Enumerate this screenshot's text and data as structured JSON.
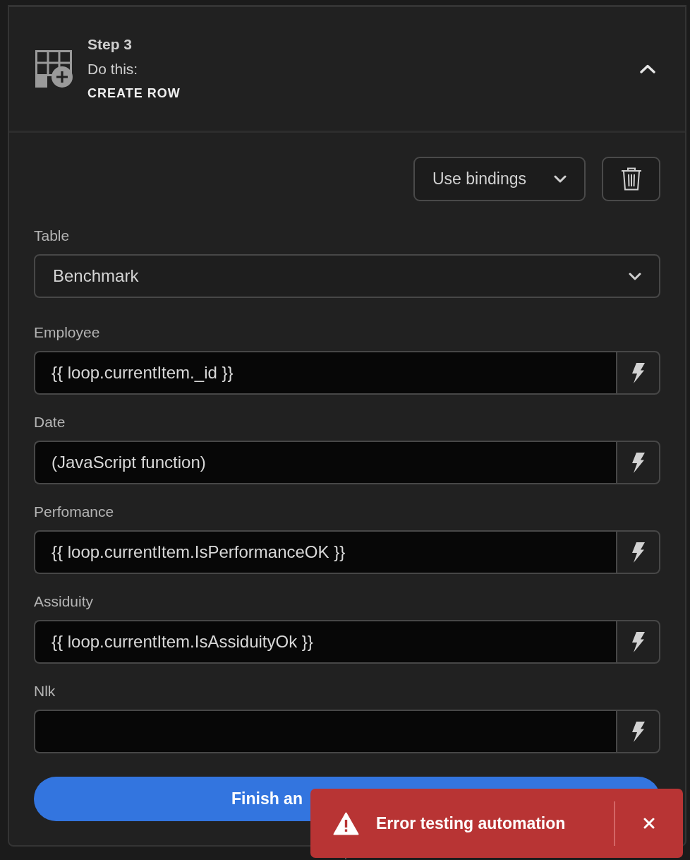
{
  "step": {
    "label": "Step 3",
    "prompt": "Do this:",
    "action": "CREATE ROW",
    "expanded": true
  },
  "toolbar": {
    "bindings_dropdown": "Use bindings"
  },
  "fields": [
    {
      "label": "Table",
      "kind": "select",
      "value": "Benchmark"
    },
    {
      "label": "Employee",
      "kind": "binding",
      "value": "{{ loop.currentItem._id }}"
    },
    {
      "label": "Date",
      "kind": "binding",
      "value": "(JavaScript function)"
    },
    {
      "label": "Perfomance",
      "kind": "binding",
      "value": "{{ loop.currentItem.IsPerformanceOK }}"
    },
    {
      "label": "Assiduity",
      "kind": "binding",
      "value": "{{ loop.currentItem.IsAssiduityOk }}"
    },
    {
      "label": "Nlk",
      "kind": "binding"
    }
  ],
  "primary_button": {
    "label": "Finish an"
  },
  "toast": {
    "message": "Error testing automation"
  }
}
